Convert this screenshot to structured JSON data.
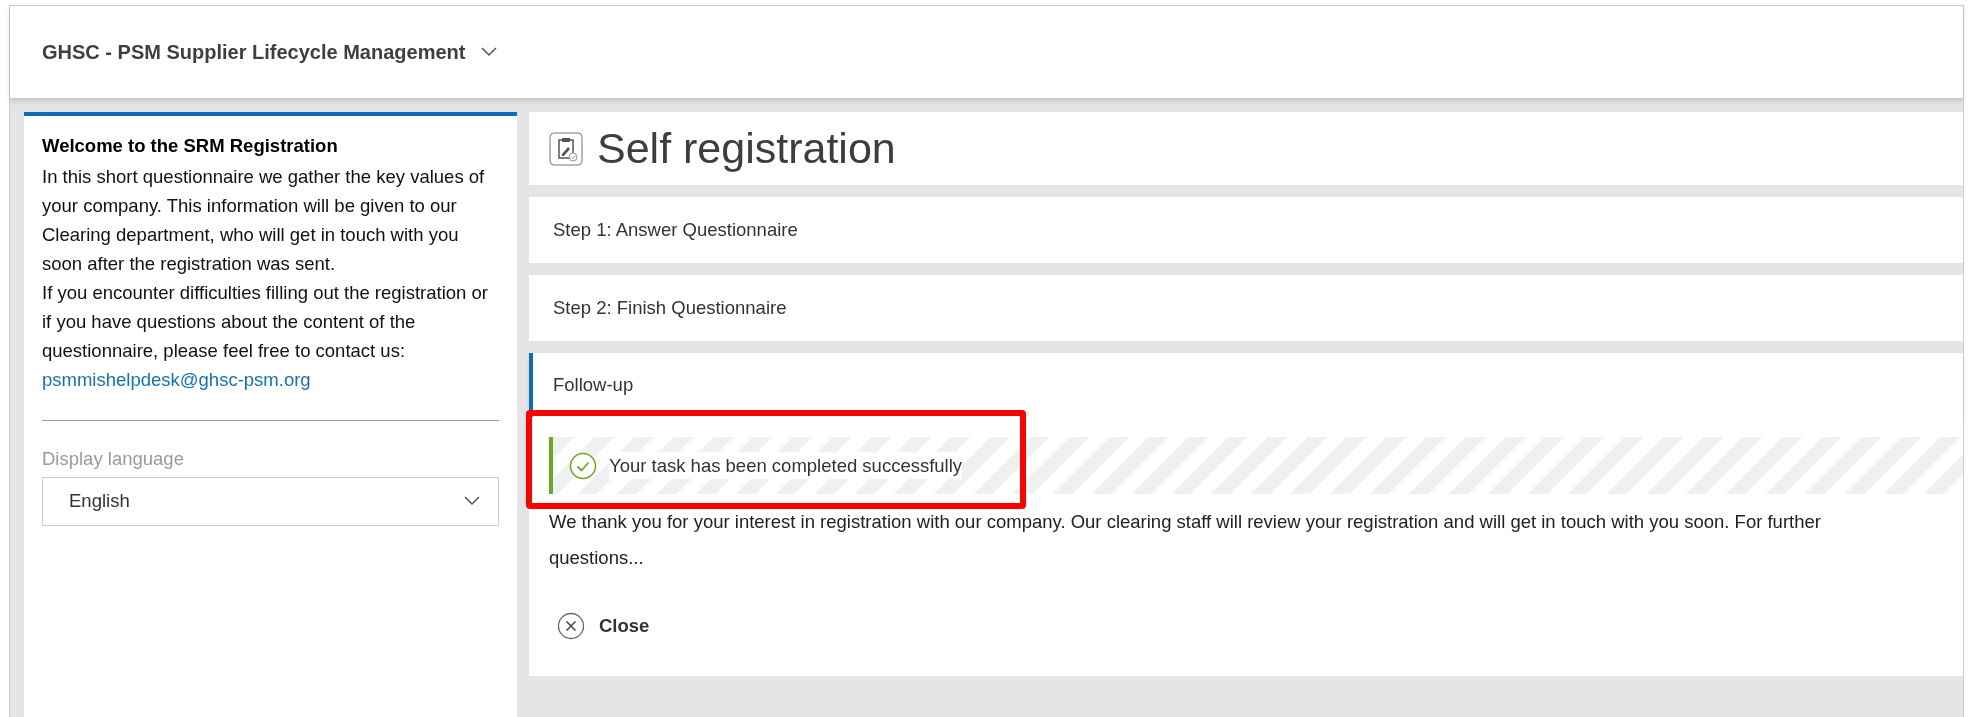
{
  "app_title": "GHSC - PSM Supplier Lifecycle Management",
  "sidebar": {
    "heading": "Welcome to the SRM Registration",
    "paragraphs": [
      "In this short questionnaire we gather the key values of your company. This information will be given to our Clearing department, who will get in touch with you soon after the registration was sent.",
      "If you encounter difficulties filling out the registration or if you have questions about the content of the questionnaire, please feel free to contact us:"
    ],
    "email": "psmmishelpdesk@ghsc-psm.org",
    "language_label": "Display language",
    "language_value": "English"
  },
  "page_title": "Self registration",
  "steps": [
    {
      "label": "Step 1: Answer Questionnaire",
      "selected": false
    },
    {
      "label": "Step 2: Finish Questionnaire",
      "selected": false
    },
    {
      "label": "Follow-up",
      "selected": true
    }
  ],
  "message": {
    "kind": "success",
    "text": "Your task has been completed successfully"
  },
  "body_text": "We thank you for your interest in registration with our company. Our clearing staff will review your registration and will get in touch with you soon. For further questions...",
  "close_button": "Close"
}
